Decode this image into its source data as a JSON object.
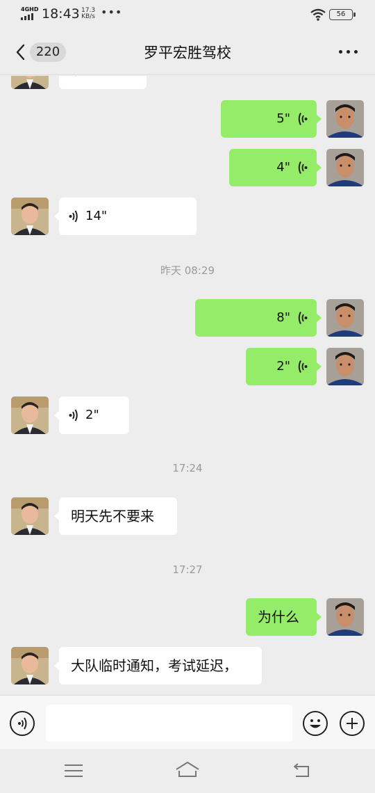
{
  "status_bar": {
    "network": "4GHD",
    "time": "18:43",
    "speed_value": "17.3",
    "speed_unit": "KB/s",
    "overflow": "•••",
    "battery": "56",
    "icons": [
      "signal-icon",
      "wifi-icon",
      "battery-icon"
    ]
  },
  "header": {
    "unread_count": "220",
    "title": "罗平宏胜驾校",
    "icons": [
      "back-arrow-icon",
      "more-icon"
    ]
  },
  "messages": [
    {
      "kind": "voice",
      "side": "in",
      "duration": "",
      "partial": true
    },
    {
      "kind": "voice",
      "side": "out",
      "duration": "5\""
    },
    {
      "kind": "voice",
      "side": "out",
      "duration": "4\""
    },
    {
      "kind": "voice",
      "side": "in",
      "duration": "14\""
    },
    {
      "kind": "time",
      "text": "昨天 08:29"
    },
    {
      "kind": "voice",
      "side": "out",
      "duration": "8\""
    },
    {
      "kind": "voice",
      "side": "out",
      "duration": "2\""
    },
    {
      "kind": "voice",
      "side": "in",
      "duration": "2\""
    },
    {
      "kind": "time",
      "text": "17:24"
    },
    {
      "kind": "text",
      "side": "in",
      "text": "明天先不要来"
    },
    {
      "kind": "time",
      "text": "17:27"
    },
    {
      "kind": "text",
      "side": "out",
      "text": "为什么"
    },
    {
      "kind": "text",
      "side": "in",
      "text": "大队临时通知，考试延迟，"
    }
  ],
  "input_bar": {
    "value": "",
    "icons": [
      "voice-input-icon",
      "emoji-icon",
      "plus-icon"
    ]
  },
  "nav_bar": {
    "icons": [
      "menu-icon",
      "home-icon",
      "back-icon"
    ]
  },
  "colors": {
    "background": "#ededed",
    "outgoing_bubble": "#95ec69",
    "incoming_bubble": "#ffffff",
    "timestamp_text": "#9a9a9a"
  }
}
